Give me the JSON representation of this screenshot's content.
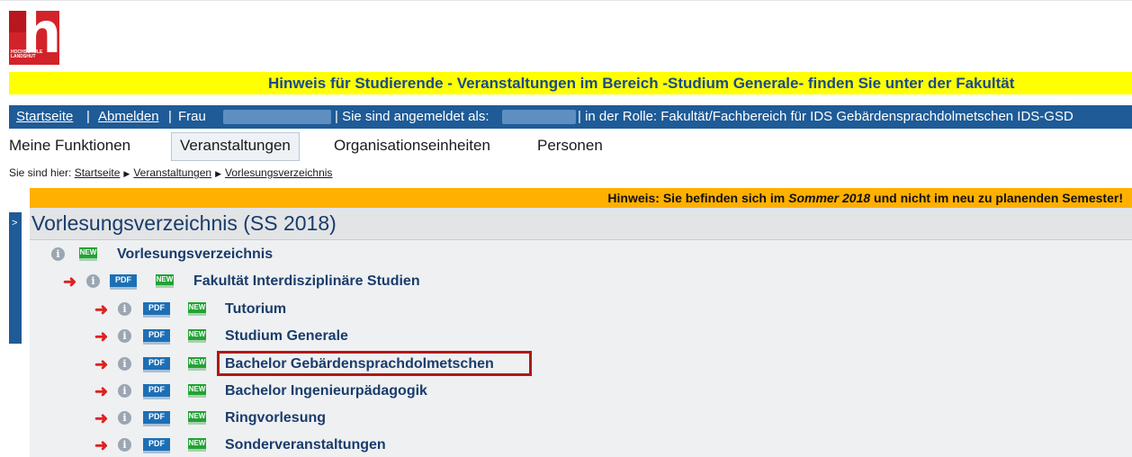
{
  "logo": {
    "text_line1": "HOCHSCHULE",
    "text_line2": "LANDSHUT",
    "alt": "hochschule-landshut-logo"
  },
  "notice_yellow": "Hinweis für Studierende - Veranstaltungen im Bereich -Studium Generale- finden Sie unter der Fakultät",
  "bluebar": {
    "startseite": "Startseite",
    "sep1": "|",
    "abmelden": "Abmelden",
    "sep2": "|",
    "frau": "Frau",
    "angemeldet": "| Sie sind angemeldet als:",
    "rolle": "|  in der Rolle: Fakultät/Fachbereich für  IDS Gebärdensprachdolmetschen IDS-GSD"
  },
  "tabs": [
    {
      "label": "Meine Funktionen"
    },
    {
      "label": "Veranstaltungen",
      "active": true
    },
    {
      "label": "Organisationseinheiten"
    },
    {
      "label": "Personen"
    }
  ],
  "breadcrumb": {
    "prefix": "Sie sind hier:",
    "items": [
      "Startseite",
      "Veranstaltungen",
      "Vorlesungsverzeichnis"
    ]
  },
  "sidebar_toggle": ">",
  "notice_orange": {
    "before": "Hinweis: Sie befinden sich im ",
    "semester": "Sommer 2018",
    "after": " und nicht im neu zu planenden Semester!"
  },
  "page_title": "Vorlesungsverzeichnis (SS 2018)",
  "icons": {
    "info": "i",
    "pdf": "PDF",
    "new": "NEW",
    "arrow": "➜"
  },
  "tree": {
    "root": "Vorlesungsverzeichnis",
    "faculty": "Fakultät Interdisziplinäre Studien",
    "children": [
      "Tutorium",
      "Studium Generale",
      "Bachelor Gebärdensprachdolmetschen",
      "Bachelor Ingenieurpädagogik",
      "Ringvorlesung",
      "Sonderveranstaltungen"
    ]
  },
  "colors": {
    "brand_red": "#d2232a",
    "notice_yellow": "#ffff00",
    "bar_blue": "#1e5b97",
    "notice_orange": "#ffb000",
    "highlight": "#b01818"
  }
}
